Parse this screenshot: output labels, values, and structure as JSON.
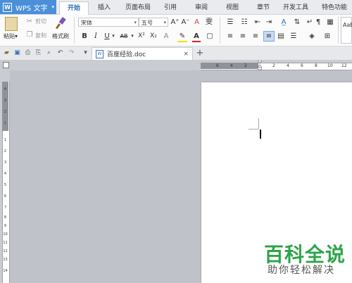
{
  "app": {
    "logo": "W",
    "name": "WPS 文字",
    "menu_arrow": "▾"
  },
  "menu": [
    "开始",
    "插入",
    "页面布局",
    "引用",
    "审阅",
    "视图",
    "章节",
    "开发工具",
    "特色功能"
  ],
  "ribbon": {
    "paste": "粘贴",
    "paste_arrow": "▾",
    "cut": "剪切",
    "copy": "复制",
    "format_painter": "格式刷",
    "font_name": "宋体",
    "font_size": "五号",
    "grow": "A⁺",
    "shrink": "A⁻",
    "clear": "A",
    "phonetic": "雯",
    "bold": "B",
    "italic": "I",
    "underline": "U",
    "strike": "AB",
    "superscript": "X²",
    "subscript": "X₂",
    "style_preview": "AaB"
  },
  "document_tab": {
    "title": "百度经验.doc",
    "close": "×",
    "new_tab": "+"
  },
  "ruler": {
    "h_ticks": [
      "6",
      "4",
      "2",
      "2",
      "4",
      "6",
      "8",
      "10",
      "12"
    ],
    "v_ticks": [
      "4",
      "3",
      "2",
      "1",
      "1",
      "2",
      "3",
      "4",
      "5",
      "6",
      "7",
      "8",
      "9",
      "10",
      "11",
      "12",
      "13",
      "14"
    ]
  },
  "watermark": {
    "line1": "百科全说",
    "line2": "助你轻松解决"
  },
  "colors": {
    "accent": "#4a8fd8",
    "active_tab_text": "#2e6db4",
    "watermark_green": "#2da44a"
  }
}
